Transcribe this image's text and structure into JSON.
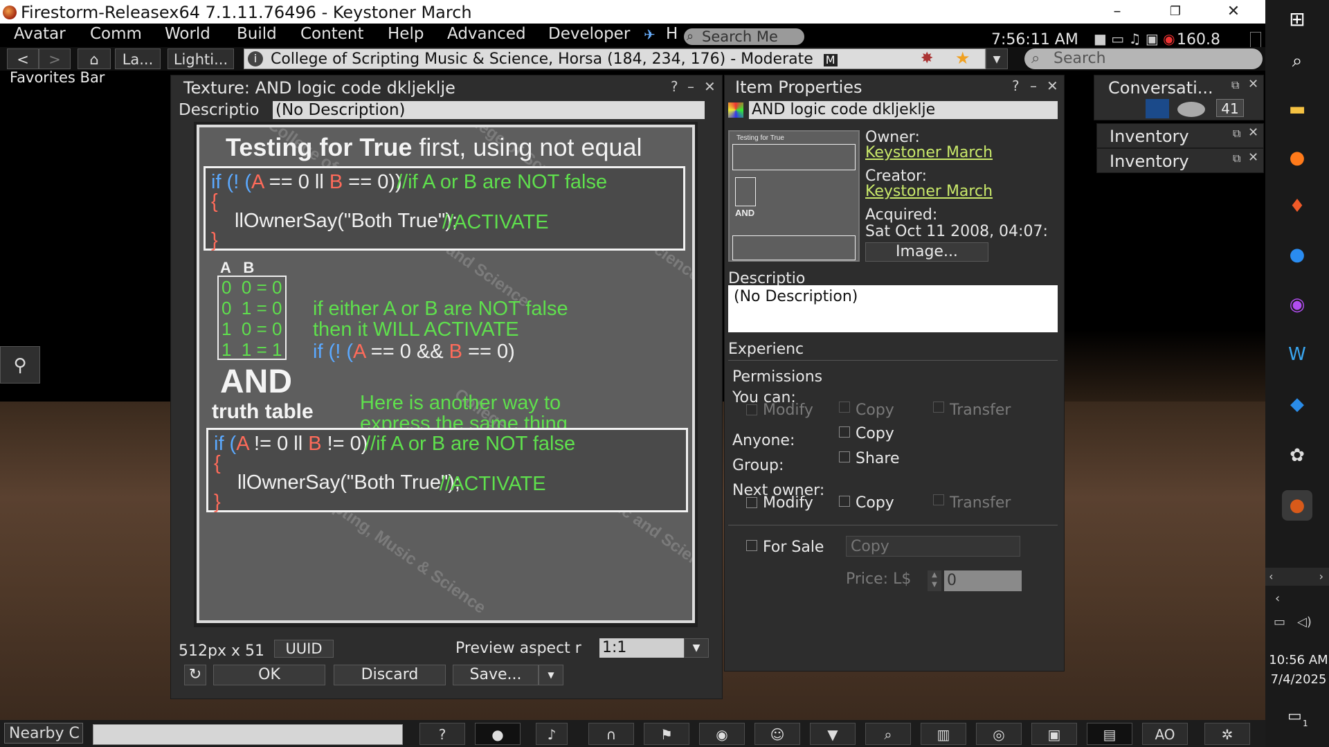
{
  "window": {
    "title": "Firestorm-Releasex64 7.1.11.76496 - Keystoner March",
    "minimize": "–",
    "maximize": "❐",
    "close": "✕"
  },
  "menu": {
    "items": [
      "Avatar",
      "Comm",
      "World",
      "Build",
      "Content",
      "Help",
      "Advanced",
      "Developer"
    ],
    "h_label": "H",
    "search_placeholder": "Search Me",
    "clock": "7:56:11 AM",
    "fps": "160.8"
  },
  "nav": {
    "back": "<",
    "forward": ">",
    "home": "⌂",
    "btn_la": "La...",
    "btn_lighting": "Lighti...",
    "location": "College of Scripting Music & Science, Horsa (184, 234, 176) - Moderate",
    "maturity_badge": "M",
    "search_placeholder": "Search",
    "favorites": "Favorites Bar"
  },
  "texture_floater": {
    "title": "Texture: AND logic code dkljeklje",
    "desc_label": "Descriptio",
    "desc_value": "(No Description)",
    "size_text": "512px x 51",
    "uuid_button": "UUID",
    "aspect_label": "Preview aspect r",
    "aspect_value": "1:1",
    "ok": "OK",
    "discard": "Discard",
    "save": "Save...",
    "help": "?",
    "min": "–",
    "close": "✕"
  },
  "texture_image": {
    "heading_bold": "Testing for True",
    "heading_rest": " first, using not equal",
    "code1_line1_a": "if (! (",
    "code1_line1_b": "A",
    "code1_line1_c": " == 0 ll ",
    "code1_line1_d": "B",
    "code1_line1_e": " == 0))",
    "code1_comment": "//if A or B are NOT false",
    "brace_open": "{",
    "brace_close": "}",
    "code1_line2": "llOwnerSay(\"Both True\");",
    "code1_comment2": "//ACTIVATE",
    "table_header": "A   B",
    "table_rows": [
      "0  0 = 0",
      "0  1 = 0",
      "1  0 = 0",
      "1  1 = 1"
    ],
    "and_big": "AND",
    "truth_table": "truth table",
    "mid_line1": "if either A or B are NOT false",
    "mid_line2": "then it WILL ACTIVATE",
    "mid_code_a": "if (! (",
    "mid_code_b": "A",
    "mid_code_c": " == 0 && ",
    "mid_code_d": "B",
    "mid_code_e": " == 0)",
    "another_1": "Here is another way to",
    "another_2": "express the same thing",
    "code2_line1_a": "if (",
    "code2_line1_b": "A",
    "code2_line1_c": " != 0 ll ",
    "code2_line1_d": "B",
    "code2_line1_e": " != 0)",
    "code2_comment": "//if A or B are NOT false",
    "code2_line2": "llOwnerSay(\"Both True\");",
    "code2_comment2": "//ACTIVATE",
    "watermark1": "College of Scripting, Music & Science",
    "watermark2": "College of Scripting, Music and Science"
  },
  "item_properties": {
    "title": "Item Properties",
    "name": "AND logic code dkljeklje",
    "owner_label": "Owner:",
    "owner": "Keystoner March",
    "creator_label": "Creator:",
    "creator": "Keystoner March",
    "acquired_label": "Acquired:",
    "acquired": "Sat Oct 11 2008, 04:07:",
    "image_button": "Image...",
    "desc_label": "Descriptio",
    "desc_value": "(No Description)",
    "experience_label": "Experienc",
    "permissions_label": "Permissions",
    "you_can_label": "You can:",
    "modify": "Modify",
    "copy": "Copy",
    "transfer": "Transfer",
    "anyone_label": "Anyone:",
    "group_label": "Group:",
    "share": "Share",
    "next_owner_label": "Next owner:",
    "for_sale": "For Sale",
    "sale_type": "Copy",
    "price_label": "Price: L$",
    "price_value": "0",
    "help": "?",
    "min": "–",
    "close": "✕"
  },
  "side_floaters": {
    "conversations": "Conversati...",
    "conv_count": "41",
    "inventory1": "Inventory",
    "inventory2": "Inventory"
  },
  "bottom": {
    "nearby_chat": "Nearby C",
    "ao": "AO",
    "buttons": [
      "help-icon",
      "speak-icon",
      "microphone-icon",
      "voice-icon",
      "movement-icon",
      "camera-view-icon",
      "people-icon",
      "appearance-icon",
      "search-icon",
      "map-icon",
      "destinations-icon",
      "snapshot-icon",
      "inventory-icon",
      "ao",
      "avatar-icon"
    ]
  },
  "taskbar": {
    "time": "10:56 AM",
    "date": "7/4/2025",
    "notif_count": "1"
  }
}
